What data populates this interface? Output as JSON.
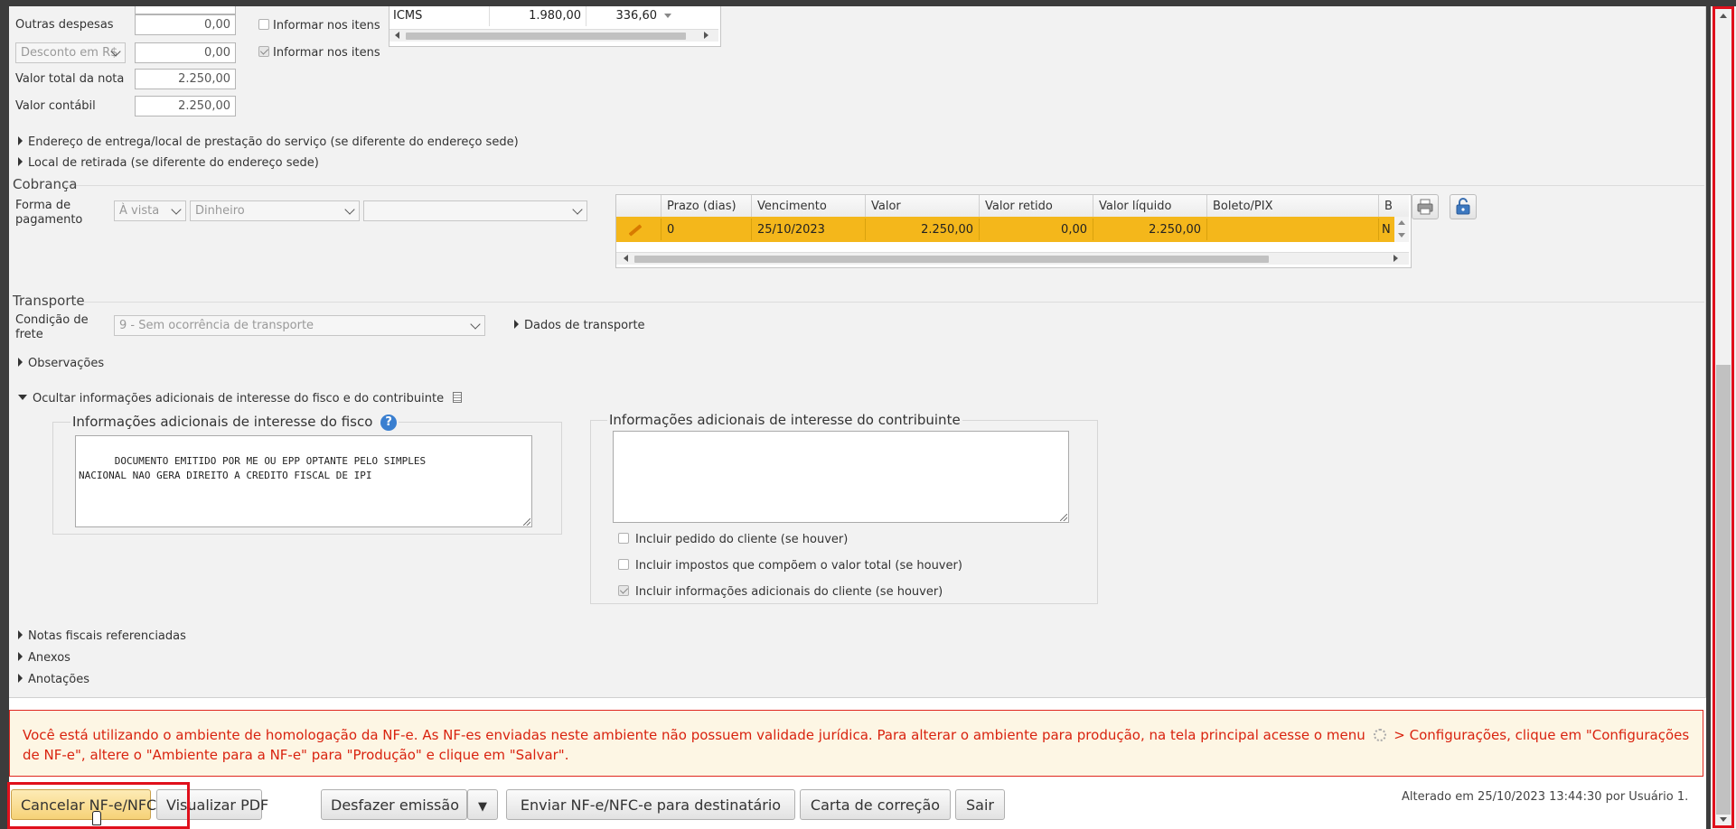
{
  "colors": {
    "accent_row": "#f4b71b",
    "warning_text": "#d9230f",
    "highlight_frame": "#e0101c",
    "primary_button": "#fbe3a0"
  },
  "totals": {
    "outras_despesas_label": "Outras despesas",
    "outras_despesas_value": "0,00",
    "informar_itens_label_1": "Informar nos itens",
    "desconto_select": "Desconto em R$",
    "desconto_value": "0,00",
    "informar_itens_label_2": "Informar nos itens",
    "valor_total_label": "Valor total da nota",
    "valor_total_value": "2.250,00",
    "valor_contabil_label": "Valor contábil",
    "valor_contabil_value": "2.250,00"
  },
  "tax_grid": {
    "name": "ICMS",
    "base": "1.980,00",
    "value": "336,60"
  },
  "collapsibles": {
    "endereco_entrega": "Endereço de entrega/local de prestação do serviço (se diferente do endereço sede)",
    "local_retirada": "Local de retirada (se diferente do endereço sede)",
    "observacoes": "Observações",
    "ocultar_info": "Ocultar informações adicionais de interesse do fisco e do contribuinte",
    "notas_referenciadas": "Notas fiscais referenciadas",
    "anexos": "Anexos",
    "anotacoes": "Anotações"
  },
  "cobranca": {
    "title": "Cobrança",
    "forma_label": "Forma de pagamento",
    "forma_select_1": "À vista",
    "forma_select_2": "Dinheiro",
    "forma_select_3": "",
    "grid": {
      "headers": [
        "Prazo (dias)",
        "Vencimento",
        "Valor",
        "Valor retido",
        "Valor líquido",
        "Boleto/PIX",
        "B"
      ],
      "row": [
        "0",
        "25/10/2023",
        "2.250,00",
        "0,00",
        "2.250,00",
        "",
        "N"
      ]
    },
    "print_icon": "printer-icon",
    "unlock_icon": "unlock-icon"
  },
  "transporte": {
    "title": "Transporte",
    "condicao_label": "Condição de frete",
    "condicao_select": "9 - Sem ocorrência de transporte",
    "dados_link": "Dados de transporte"
  },
  "info_fisco": {
    "legend": "Informações adicionais de interesse do fisco",
    "text": "DOCUMENTO EMITIDO POR ME OU EPP OPTANTE PELO SIMPLES\nNACIONAL NAO GERA DIREITO A CREDITO FISCAL DE IPI"
  },
  "info_contribuinte": {
    "legend": "Informações adicionais de interesse do contribuinte",
    "text": "",
    "chk_pedido": "Incluir pedido do cliente (se houver)",
    "chk_impostos": "Incluir impostos que compõem o valor total (se houver)",
    "chk_info_cliente": "Incluir informações adicionais do cliente (se houver)"
  },
  "warning": {
    "text_part1": "Você está utilizando o ambiente de homologação da NF-e. As NF-es enviadas neste ambiente não possuem validade jurídica. Para alterar o ambiente para produção, na tela principal acesse o menu",
    "text_part2": "> Configurações, clique em \"Configurações de NF-e\", altere o \"Ambiente para a NF-e\" para \"Produção\" e clique em \"Salvar\"."
  },
  "footer": {
    "cancelar": "Cancelar NF-e/NFC-e",
    "visualizar": "Visualizar PDF",
    "desfazer": "Desfazer emissão",
    "dropdown_glyph": "▼",
    "enviar": "Enviar NF-e/NFC-e para destinatário",
    "carta": "Carta de correção",
    "sair": "Sair",
    "alterado": "Alterado em 25/10/2023 13:44:30 por Usuário 1."
  }
}
